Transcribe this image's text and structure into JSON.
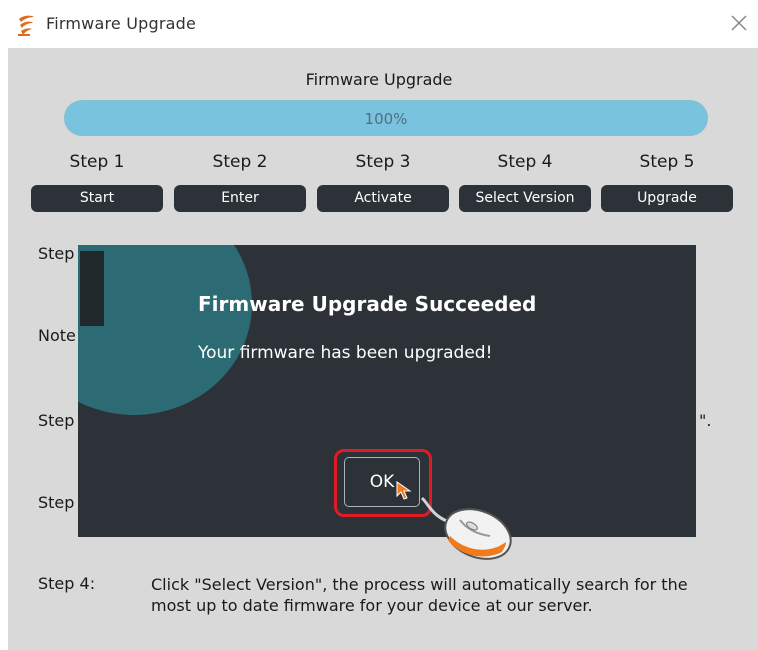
{
  "window": {
    "title": "Firmware Upgrade",
    "icon": "app-logo-icon",
    "close_icon": "close-icon"
  },
  "heading": "Firmware Upgrade",
  "progress": {
    "percent": 100,
    "label": "100%"
  },
  "steps": [
    {
      "label": "Step 1",
      "button": "Start"
    },
    {
      "label": "Step 2",
      "button": "Enter"
    },
    {
      "label": "Step 3",
      "button": "Activate"
    },
    {
      "label": "Step 4",
      "button": "Select Version"
    },
    {
      "label": "Step 5",
      "button": "Upgrade"
    }
  ],
  "background_text": {
    "line1": "Step",
    "line2": "Note",
    "line3": "Step",
    "line3_tail": "\".",
    "line4": "Step",
    "step4_label": "Step 4:",
    "step4_text": "Click \"Select Version\", the process will automatically search for the most up to date firmware for your device at our server."
  },
  "dialog": {
    "title": "Firmware Upgrade Succeeded",
    "message": "Your firmware has been upgraded!",
    "ok_label": "OK",
    "icon": "info-icon"
  },
  "colors": {
    "panel": "#d9d9d9",
    "progress": "#79c3de",
    "button": "#2c3237",
    "dialog": "#2c3237",
    "info_circle": "#2c6b73",
    "highlight": "#e01b24",
    "cursor": "#f07a1c"
  }
}
